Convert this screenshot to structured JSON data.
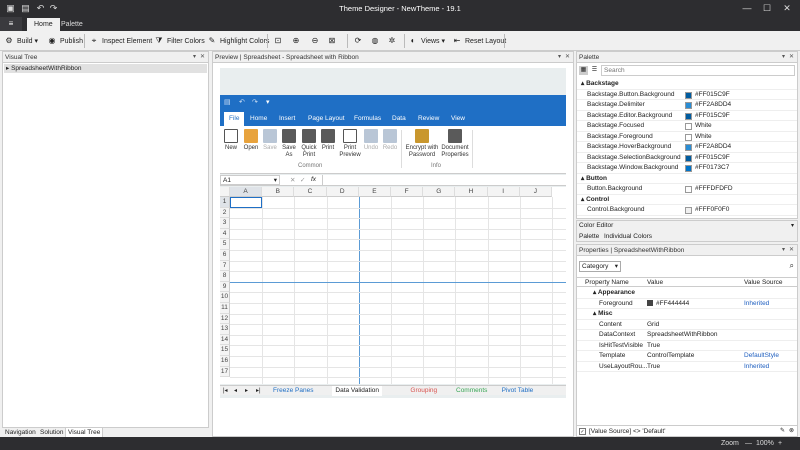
{
  "window": {
    "title": "Theme Designer - NewTheme - 19.1"
  },
  "menu": {
    "tabs": [
      "Home",
      "Palette"
    ],
    "active": "Home"
  },
  "toolbar": {
    "build": "Build",
    "publish": "Publish",
    "inspect": "Inspect Element",
    "filter": "Filter Colors",
    "highlight": "Highlight Colors",
    "views": "Views",
    "reset": "Reset Layout"
  },
  "visual_tree": {
    "header": "Visual Tree",
    "root": "SpreadsheetWithRibbon",
    "nav_tabs": [
      "Navigation",
      "Solution",
      "Visual Tree"
    ],
    "active_tab": "Visual Tree"
  },
  "preview": {
    "header": "Preview | Spreadsheet - Spreadsheet with Ribbon",
    "ribbon_tabs": [
      "File",
      "Home",
      "Insert",
      "Page Layout",
      "Formulas",
      "Data",
      "Review",
      "View"
    ],
    "active_tab": "File",
    "common_buttons": [
      "New",
      "Open",
      "Save",
      "Save As",
      "Quick Print",
      "Print",
      "Print Preview",
      "Undo",
      "Redo"
    ],
    "info_buttons": [
      "Encrypt with Password",
      "Document Properties"
    ],
    "groups": [
      "Common",
      "Info"
    ],
    "name_box": "A1",
    "fx": "fx",
    "columns": [
      "A",
      "B",
      "C",
      "D",
      "E",
      "F",
      "G",
      "H",
      "I",
      "J"
    ],
    "rows": [
      "1",
      "2",
      "3",
      "4",
      "5",
      "6",
      "7",
      "8",
      "9",
      "10",
      "11",
      "12",
      "13",
      "14",
      "15",
      "16",
      "17"
    ],
    "sheet_tabs": [
      {
        "label": "Freeze Panes",
        "color": "#1f6fc5"
      },
      {
        "label": "Data Validation",
        "color": "#222222"
      },
      {
        "label": "Grouping",
        "color": "#d9534f"
      },
      {
        "label": "Comments",
        "color": "#3aa757"
      },
      {
        "label": "Pivot Table",
        "color": "#1f6fc5"
      }
    ]
  },
  "palette": {
    "header": "Palette",
    "search_placeholder": "Search",
    "rows": [
      {
        "type": "cat",
        "name": "Backstage"
      },
      {
        "type": "item",
        "name": "Backstage.Button.Background",
        "color": "#015C9F",
        "value": "#FF015C9F"
      },
      {
        "type": "item",
        "name": "Backstage.Delimiter",
        "color": "#2A8DD4",
        "value": "#FF2A8DD4"
      },
      {
        "type": "item",
        "name": "Backstage.Editor.Background",
        "color": "#015C9F",
        "value": "#FF015C9F"
      },
      {
        "type": "item",
        "name": "Backstage.Focused",
        "color": "#FFFFFF",
        "value": "White"
      },
      {
        "type": "item",
        "name": "Backstage.Foreground",
        "color": "#FFFFFF",
        "value": "White"
      },
      {
        "type": "item",
        "name": "Backstage.HoverBackground",
        "color": "#2A8DD4",
        "value": "#FF2A8DD4"
      },
      {
        "type": "item",
        "name": "Backstage.SelectionBackground",
        "color": "#015C9F",
        "value": "#FF015C9F"
      },
      {
        "type": "item",
        "name": "Backstage.Window.Background",
        "color": "#0173C7",
        "value": "#FF0173C7"
      },
      {
        "type": "cat",
        "name": "Button"
      },
      {
        "type": "item",
        "name": "Button.Background",
        "color": "#FDFDFD",
        "value": "#FFFDFDFD"
      },
      {
        "type": "cat",
        "name": "Control"
      },
      {
        "type": "item",
        "name": "Control.Background",
        "color": "#F0F0F0",
        "value": "#FFF0F0F0"
      }
    ]
  },
  "color_editor": {
    "header": "Color Editor",
    "tabs": [
      "Palette",
      "Individual Colors"
    ]
  },
  "properties": {
    "header": "Properties | SpreadsheetWithRibbon",
    "category": "Category",
    "columns": [
      "Property Name",
      "Value",
      "Value Source"
    ],
    "rows": [
      {
        "type": "cat",
        "name": "Appearance"
      },
      {
        "type": "item",
        "name": "Foreground",
        "value": "#FF444444",
        "swatch": "#444444",
        "source": "Inherited"
      },
      {
        "type": "cat",
        "name": "Misc"
      },
      {
        "type": "item",
        "name": "Content",
        "value": "Grid",
        "source": ""
      },
      {
        "type": "item",
        "name": "DataContext",
        "value": "SpreadsheetWithRibbon",
        "source": ""
      },
      {
        "type": "item",
        "name": "IsHitTestVisible",
        "value": "True",
        "source": ""
      },
      {
        "type": "item",
        "name": "Template",
        "value": "ControlTemplate",
        "source": "DefaultStyle"
      },
      {
        "type": "item",
        "name": "UseLayoutRou...",
        "value": "True",
        "source": "Inherited"
      }
    ],
    "filter_text": "[Value Source] <> 'Default'"
  },
  "status": {
    "zoom_label": "Zoom",
    "zoom_value": "100%"
  }
}
